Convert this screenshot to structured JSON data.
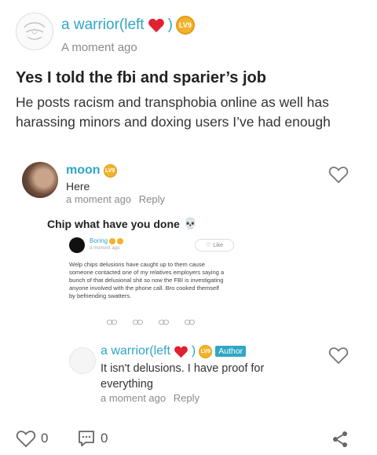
{
  "post": {
    "author": "a warrior(left",
    "author_close": ")",
    "level": "LV9",
    "timestamp": "A moment ago",
    "title": "Yes I told the fbi and sparier’s job",
    "body": "He posts racism and transphobia online as well has harassing minors and doxing users I’ve had enough"
  },
  "comment": {
    "author": "moon",
    "level": "LV9",
    "text": "Here",
    "timestamp": "a moment ago",
    "reply_label": "Reply",
    "quote_title": "Chip what have you done",
    "embed": {
      "author": "Boring",
      "timestamp": "a moment ago",
      "like_label": "Like",
      "body": "Welp chips delusions have caught up to them cause someone contacted one of my relatives employers saying a bunch of that delusional shit so now the FBI is investigating anyone involved with the phone call. Bro cooked themself by befriending swatters."
    }
  },
  "reply": {
    "author": "a warrior(left",
    "author_close": ")",
    "level": "LV9",
    "tag": "Author",
    "text": "It isn't delusions. I have proof for everything",
    "timestamp": "a moment ago",
    "reply_label": "Reply"
  },
  "footer": {
    "likes": "0",
    "comments": "0"
  },
  "colors": {
    "accent": "#2fa7c4",
    "badge": "#f1b32b",
    "heart": "#e0222f"
  }
}
